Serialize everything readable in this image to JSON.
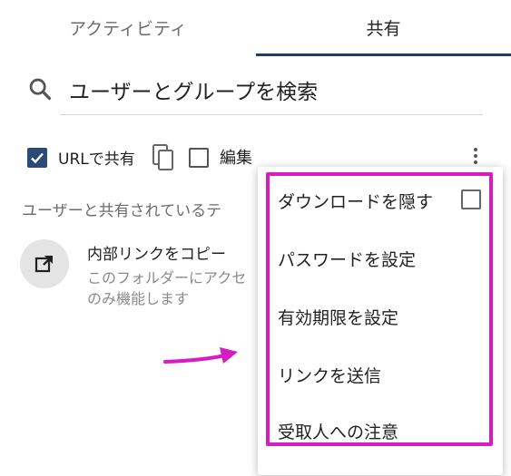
{
  "tabs": {
    "activity": "アクティビティ",
    "share": "共有",
    "active": "share"
  },
  "search": {
    "icon": "search-icon",
    "text": "ユーザーとグループを検索"
  },
  "share_row": {
    "url_share_label": "URLで共有",
    "url_share_checked": true,
    "copy_icon": "copy-icon",
    "edit_label": "編集",
    "edit_checked": false,
    "more_icon": "more-vertical-icon"
  },
  "shared_hint": "ユーザーと共有されているテ",
  "internal_link": {
    "icon": "external-link-icon",
    "title": "内部リンクをコピー",
    "desc_line1": "このフォルダーにアクセ",
    "desc_line2": "のみ機能します"
  },
  "menu": {
    "items": [
      {
        "label": "ダウンロードを隠す",
        "has_checkbox": true,
        "checked": false
      },
      {
        "label": "パスワードを設定"
      },
      {
        "label": "有効期限を設定"
      },
      {
        "label": "リンクを送信"
      },
      {
        "label": "受取人への注意"
      }
    ]
  },
  "colors": {
    "accent": "#1e3c72",
    "checkbox": "#2b4a78",
    "highlight": "#d81bc3"
  }
}
